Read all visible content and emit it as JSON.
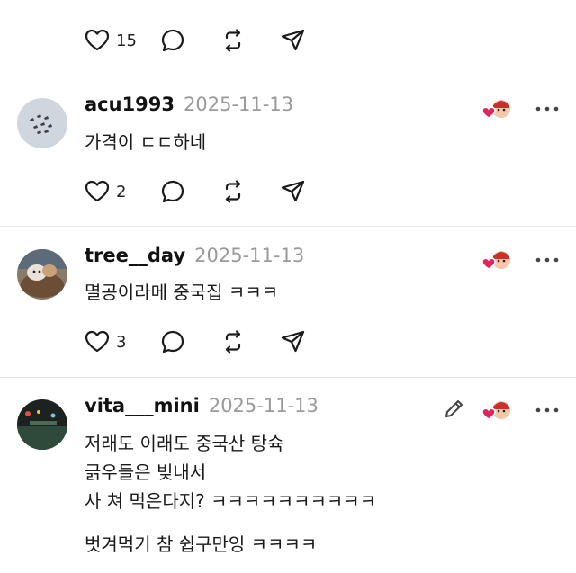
{
  "top_post": {
    "partial_text": "",
    "like_count": "15"
  },
  "comments": [
    {
      "username": "acu1993",
      "date": "2025-11-13",
      "lines": [
        "가격이 ㄷㄷ하네"
      ],
      "like_count": "2"
    },
    {
      "username": "tree__day",
      "date": "2025-11-13",
      "lines": [
        "멸공이라메 중국집 ㅋㅋㅋ"
      ],
      "like_count": "3"
    },
    {
      "username": "vita___mini",
      "date": "2025-11-13",
      "lines": [
        "저래도 이래도 중국산 탕슉",
        "긁우들은 빚내서",
        "사 쳐 먹은다지? ㅋㅋㅋㅋㅋㅋㅋㅋㅋㅋ",
        "",
        "벗겨먹기 참 쉽구만잉 ㅋㅋㅋㅋ"
      ]
    }
  ],
  "icons": {
    "like": "heart-outline-icon",
    "reply": "speech-bubble-icon",
    "repost": "repost-arrows-icon",
    "share": "paper-plane-icon",
    "more": "more-horizontal-icon",
    "badge": "liked-by-author-badge",
    "edit": "pencil-icon"
  },
  "colors": {
    "heart_red": "#e0245e",
    "divider": "#e5e5e5",
    "date_gray": "#9a9a9a"
  }
}
